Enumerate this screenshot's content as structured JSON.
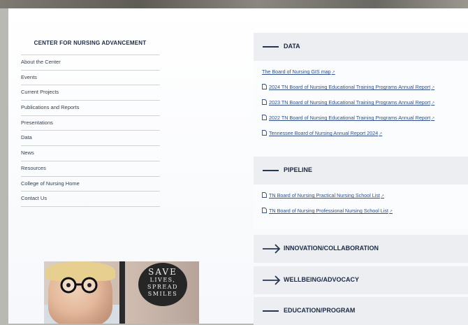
{
  "nav": {
    "title": "CENTER FOR NURSING ADVANCEMENT",
    "items": [
      "About the Center",
      "Events",
      "Current Projects",
      "Publications and Reports",
      "Presentations",
      "Data",
      "News",
      "Resources",
      "College of Nursing Home",
      "Contact Us"
    ]
  },
  "promo": {
    "line1": "SAVE",
    "line2": "LIVES,",
    "line3": "SPREAD",
    "line4": "SMILES"
  },
  "sections": {
    "data": {
      "title": "DATA",
      "links": [
        "The Board of Nursing GIS map",
        "2024 TN Board of Nursing Educational Training Programs Annual Report",
        "2023 TN Board of Nursing Educational Training Programs Annual Report",
        "2022 TN Board of Nursing Educational Training Programs Annual Report",
        "Tennessee Board of Nursing Annual Report 2024"
      ]
    },
    "pipeline": {
      "title": "PIPELINE",
      "links": [
        "TN Board of Nursing Practical Nursing School List",
        "TN Board of Nursing Professional Nursing School List"
      ]
    },
    "innovation": {
      "title": "INNOVATION/COLLABORATION"
    },
    "wellbeing": {
      "title": "WELLBEING/ADVOCACY"
    },
    "education": {
      "title": "EDUCATION/PROGRAM"
    }
  },
  "icons": {
    "expanded": "dash-icon",
    "collapsed": "arrow-right-icon",
    "document": "document-icon",
    "external": "external-link-icon"
  },
  "colors": {
    "heading": "#1b2a44",
    "link": "#2f4e86",
    "panel": "#eceef1"
  }
}
